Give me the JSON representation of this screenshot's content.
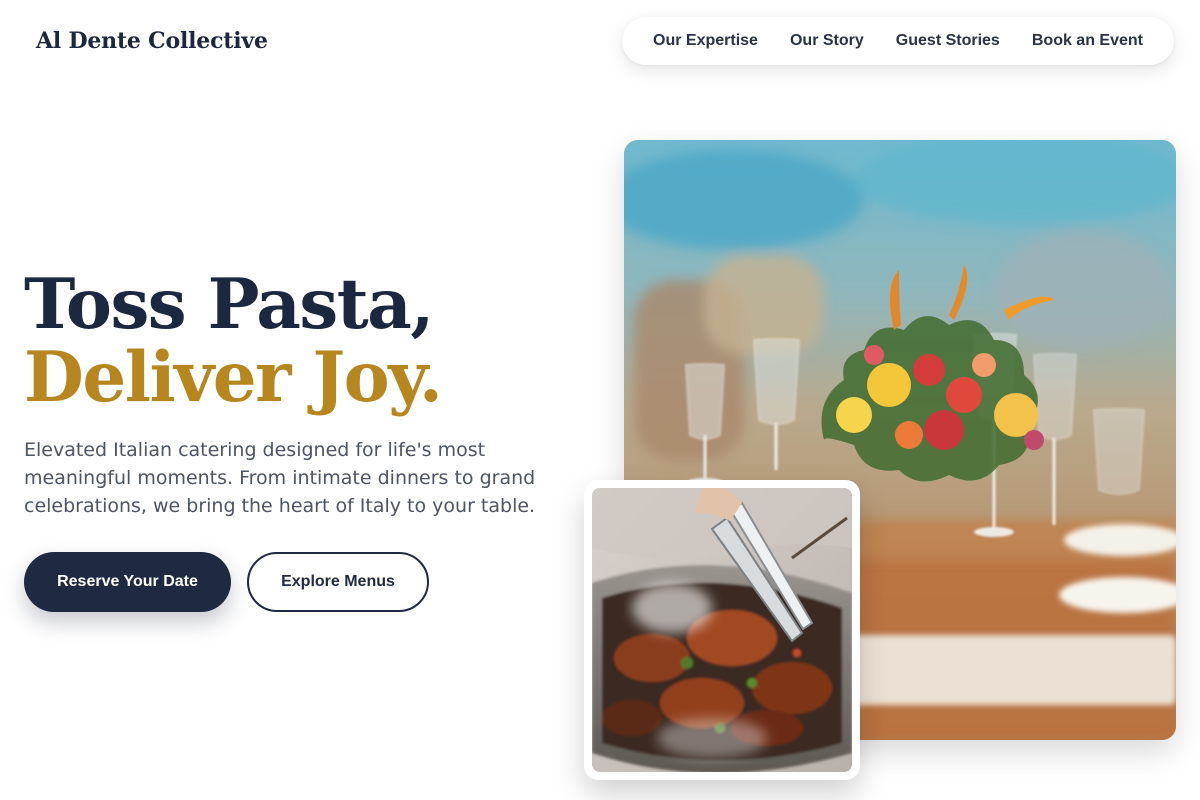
{
  "brand": {
    "name": "Al Dente Collective"
  },
  "nav": {
    "items": [
      {
        "label": "Our Expertise"
      },
      {
        "label": "Our Story"
      },
      {
        "label": "Guest Stories"
      },
      {
        "label": "Book an Event"
      }
    ]
  },
  "hero": {
    "title_line1": "Toss Pasta,",
    "title_line2": "Deliver Joy.",
    "description": "Elevated Italian catering designed for life's most meaningful moments. From intimate dinners to grand celebrations, we bring the heart of Italy to your table.",
    "primary_button": "Reserve Your Date",
    "secondary_button": "Explore Menus"
  },
  "images": {
    "main": "banquet-table-floral-centerpiece-photo",
    "secondary": "grilled-meat-tongs-tray-photo"
  },
  "colors": {
    "navy": "#1c2740",
    "gold": "#b8861f",
    "body_text": "#4b5566",
    "button_dark": "#1f2941"
  }
}
